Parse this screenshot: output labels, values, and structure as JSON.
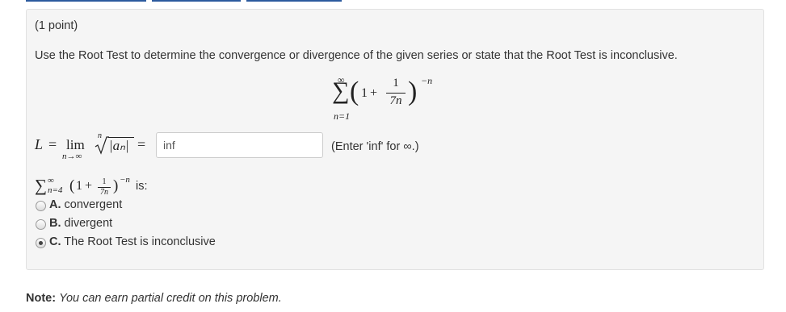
{
  "problem": {
    "points": "(1 point)",
    "instruction": "Use the Root Test to determine the convergence or divergence of the given series or state that the Root Test is inconclusive.",
    "series": {
      "sigma": "∑",
      "upper": "∞",
      "lower": "n=1",
      "one": "1",
      "plus": "+",
      "numerator": "1",
      "denominator": "7n",
      "exponent": "−n",
      "lparen": "(",
      "rparen": ")"
    },
    "limit": {
      "L": "L",
      "equals": "=",
      "lim": "lim",
      "sub": "n→∞",
      "root_index": "n",
      "radicand": "|aₙ|",
      "equals2": "=",
      "input_value": "inf",
      "hint": "(Enter 'inf' for ∞.)"
    },
    "series_inline": {
      "sigma": "∑",
      "upper": "∞",
      "lower": "n=4",
      "lparen": "(",
      "one": "1",
      "plus": "+",
      "numerator": "1",
      "denominator": "7n",
      "rparen": ")",
      "exponent": "−n",
      "suffix": "is:"
    },
    "options": [
      {
        "letter": "A.",
        "text": "convergent",
        "checked": false
      },
      {
        "letter": "B.",
        "text": "divergent",
        "checked": false
      },
      {
        "letter": "C.",
        "text": "The Root Test is inconclusive",
        "checked": true
      }
    ]
  },
  "note": {
    "label": "Note:",
    "text": "You can earn partial credit on this problem."
  }
}
